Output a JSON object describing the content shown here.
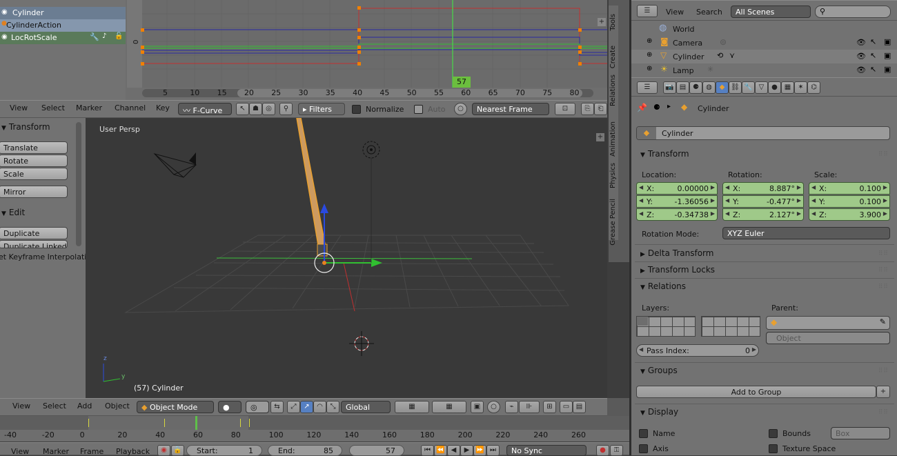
{
  "graph": {
    "channels": [
      "Cylinder",
      "CylinderAction",
      "LocRotScale"
    ],
    "ruler": [
      "5",
      "10",
      "15",
      "20",
      "25",
      "30",
      "35",
      "40",
      "45",
      "50",
      "55",
      "60",
      "65",
      "70",
      "75",
      "80"
    ],
    "current_frame_badge": "57",
    "y_zero": "0",
    "side_tabs": [
      "Tools",
      "Create",
      "Relations",
      "Animation",
      "Physics",
      "Grease Pencil"
    ]
  },
  "graph_header": {
    "menus": [
      "View",
      "Select",
      "Marker",
      "Channel",
      "Key"
    ],
    "mode": "F-Curve",
    "filters": "Filters",
    "normalize": "Normalize",
    "auto": "Auto",
    "snap": "Nearest Frame"
  },
  "toolshelf": {
    "transform_title": "Transform",
    "translate": "Translate",
    "rotate": "Rotate",
    "scale": "Scale",
    "mirror": "Mirror",
    "edit_title": "Edit",
    "duplicate": "Duplicate",
    "duplicate_linked": "Duplicate Linked",
    "interp": "et Keyframe Interpolati"
  },
  "viewport": {
    "label": "User Persp",
    "object_label": "(57) Cylinder",
    "axis_z": "z",
    "axis_y": "y"
  },
  "view_header": {
    "menus": [
      "View",
      "Select",
      "Add",
      "Object"
    ],
    "mode": "Object Mode",
    "orientation": "Global"
  },
  "timeline": {
    "ruler": [
      "-40",
      "-20",
      "0",
      "20",
      "40",
      "60",
      "80",
      "100",
      "120",
      "140",
      "160",
      "180",
      "200",
      "220",
      "240",
      "260"
    ],
    "menus": [
      "View",
      "Marker",
      "Frame",
      "Playback"
    ],
    "start_label": "Start:",
    "start": "1",
    "end_label": "End:",
    "end": "85",
    "current": "57",
    "sync": "No Sync"
  },
  "outliner": {
    "menus": [
      "View",
      "Search"
    ],
    "scene_select": "All Scenes",
    "items": [
      "World",
      "Camera",
      "Cylinder",
      "Lamp"
    ]
  },
  "properties": {
    "breadcrumb": "Cylinder",
    "object_name": "Cylinder",
    "transform": {
      "title": "Transform",
      "location_label": "Location:",
      "rotation_label": "Rotation:",
      "scale_label": "Scale:",
      "location": [
        {
          "a": "X:",
          "v": "0.00000"
        },
        {
          "a": "Y:",
          "v": "-1.36056"
        },
        {
          "a": "Z:",
          "v": "-0.34738"
        }
      ],
      "rotation": [
        {
          "a": "X:",
          "v": "8.887°"
        },
        {
          "a": "Y:",
          "v": "-0.477°"
        },
        {
          "a": "Z:",
          "v": "2.127°"
        }
      ],
      "scale": [
        {
          "a": "X:",
          "v": "0.100"
        },
        {
          "a": "Y:",
          "v": "0.100"
        },
        {
          "a": "Z:",
          "v": "3.900"
        }
      ],
      "rotation_mode_label": "Rotation Mode:",
      "rotation_mode": "XYZ Euler"
    },
    "delta_transform": "Delta Transform",
    "transform_locks": "Transform Locks",
    "relations": {
      "title": "Relations",
      "layers_label": "Layers:",
      "parent_label": "Parent:",
      "parent_type": "Object",
      "pass_index_label": "Pass Index:",
      "pass_index": "0"
    },
    "groups": {
      "title": "Groups",
      "add": "Add to Group"
    },
    "display": {
      "title": "Display",
      "name": "Name",
      "axis": "Axis",
      "bounds": "Bounds",
      "bounds_type": "Box",
      "texture_space": "Texture Space"
    }
  }
}
